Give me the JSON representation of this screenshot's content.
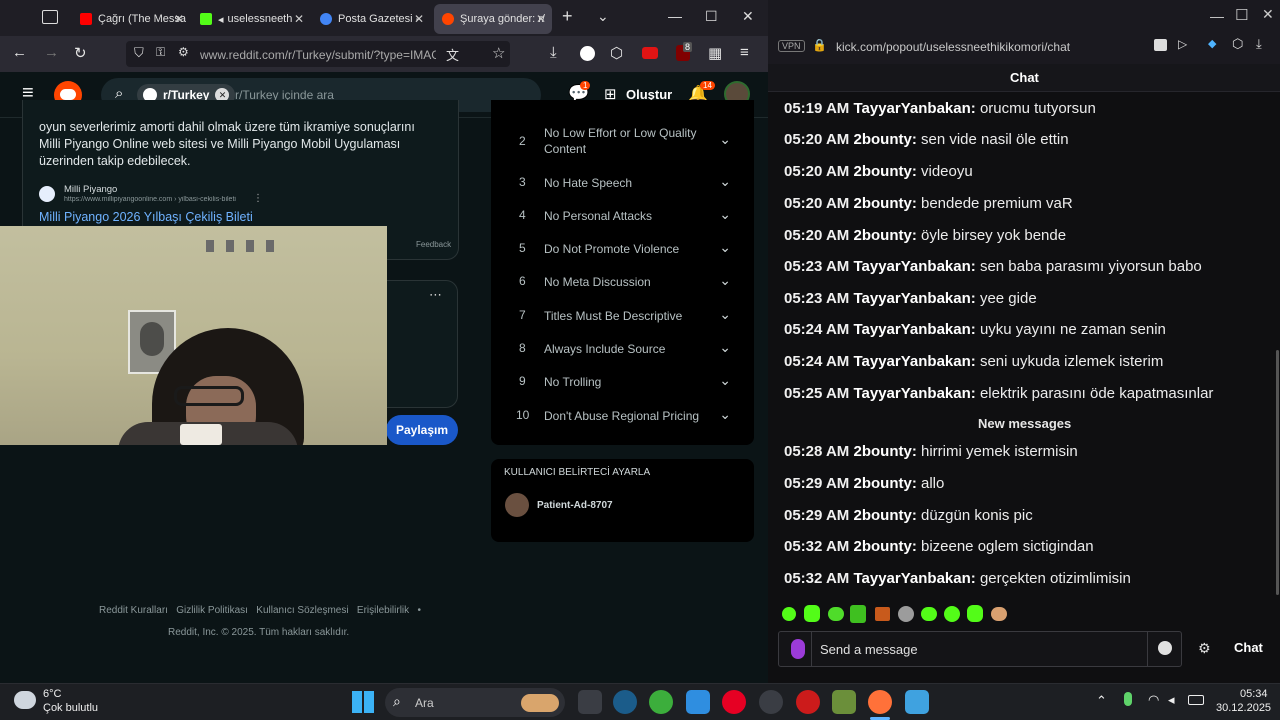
{
  "browser": {
    "tabs": [
      {
        "label": "Çağrı (The Messa",
        "color": "#ff0000"
      },
      {
        "label": "uselessneeth",
        "color": "#53fc18"
      },
      {
        "label": "Posta Gazetesi -",
        "color": "#4285f4"
      },
      {
        "label": "Şuraya gönder: r/",
        "color": "#ff4500"
      }
    ],
    "url": "www.reddit.com/r/Turkey/submit/?type=IMAGE",
    "translate_icon": "translate-icon",
    "badge_count": "8"
  },
  "reddit": {
    "subreddit_chip": "r/Turkey",
    "search_placeholder": "r/Turkey içinde ara",
    "create_label": "Oluştur",
    "notif_count": "14",
    "chat_count": "1",
    "post_text": "oyun severlerimiz amorti dahil olmak üzere tüm ikramiye sonuçlarını Milli Piyango Online web sitesi ve Milli Piyango Mobil Uygulaması üzerinden takip edebilecek.",
    "link_source": "Milli Piyango",
    "link_url": "https://www.millipiyangoonline.com › yilbasi-cekilis-bileti",
    "link_title": "Milli Piyango 2026 Yılbaşı Çekiliş Bileti",
    "feedback": "Feedback",
    "share_button": "Paylaşım",
    "rules": [
      {
        "num": "2",
        "text": "No Low Effort or Low Quality Content"
      },
      {
        "num": "3",
        "text": "No Hate Speech"
      },
      {
        "num": "4",
        "text": "No Personal Attacks"
      },
      {
        "num": "5",
        "text": "Do Not Promote Violence"
      },
      {
        "num": "6",
        "text": "No Meta Discussion"
      },
      {
        "num": "7",
        "text": "Titles Must Be Descriptive"
      },
      {
        "num": "8",
        "text": "Always Include Source"
      },
      {
        "num": "9",
        "text": "No Trolling"
      },
      {
        "num": "10",
        "text": "Don't Abuse Regional Pricing"
      }
    ],
    "flair_title": "KULLANICI BELİRTECİ AYARLA",
    "flair_user": "Patient-Ad-8707",
    "footer_links": [
      "Reddit Kuralları",
      "Gizlilik Politikası",
      "Kullanıcı Sözleşmesi",
      "Erişilebilirlik",
      "•"
    ],
    "footer_copy": "Reddit, Inc. © 2025. Tüm hakları saklıdır."
  },
  "kick": {
    "vpn": "VPN",
    "url": "kick.com/popout/uselessneethikikomori/chat",
    "header": "Chat",
    "messages": [
      {
        "time": "05:19 AM",
        "user": "TayyarYanbakan:",
        "text": "orucmu tutyorsun"
      },
      {
        "time": "05:20 AM",
        "user": "2bounty:",
        "text": "sen vide nasil öle ettin"
      },
      {
        "time": "05:20 AM",
        "user": "2bounty:",
        "text": "videoyu"
      },
      {
        "time": "05:20 AM",
        "user": "2bounty:",
        "text": "bendede premium vaR"
      },
      {
        "time": "05:20 AM",
        "user": "2bounty:",
        "text": "öyle birsey yok bende"
      },
      {
        "time": "05:23 AM",
        "user": "TayyarYanbakan:",
        "text": "sen baba parasımı yiyorsun babo"
      },
      {
        "time": "05:23 AM",
        "user": "TayyarYanbakan:",
        "text": "yee gide"
      },
      {
        "time": "05:24 AM",
        "user": "TayyarYanbakan:",
        "text": "uyku yayını ne zaman senin"
      },
      {
        "time": "05:24 AM",
        "user": "TayyarYanbakan:",
        "text": "seni uykuda izlemek isterim"
      },
      {
        "time": "05:25 AM",
        "user": "TayyarYanbakan:",
        "text": "elektrik parasını öde kapatmasınlar"
      }
    ],
    "new_messages": "New messages",
    "messages2": [
      {
        "time": "05:28 AM",
        "user": "2bounty:",
        "text": "hirrimi yemek istermisin"
      },
      {
        "time": "05:29 AM",
        "user": "2bounty:",
        "text": "allo"
      },
      {
        "time": "05:29 AM",
        "user": "2bounty:",
        "text": "düzgün konis pic"
      },
      {
        "time": "05:32 AM",
        "user": "2bounty:",
        "text": "bizeene oglem sictigindan"
      },
      {
        "time": "05:32 AM",
        "user": "TayyarYanbakan:",
        "text": "gerçekten otizimlimisin"
      }
    ],
    "input_placeholder": "Send a message",
    "send_label": "Chat"
  },
  "taskbar": {
    "weather_temp": "6°C",
    "weather_desc": "Çok bulutlu",
    "search_label": "Ara",
    "time": "05:34",
    "date": "30.12.2025"
  }
}
